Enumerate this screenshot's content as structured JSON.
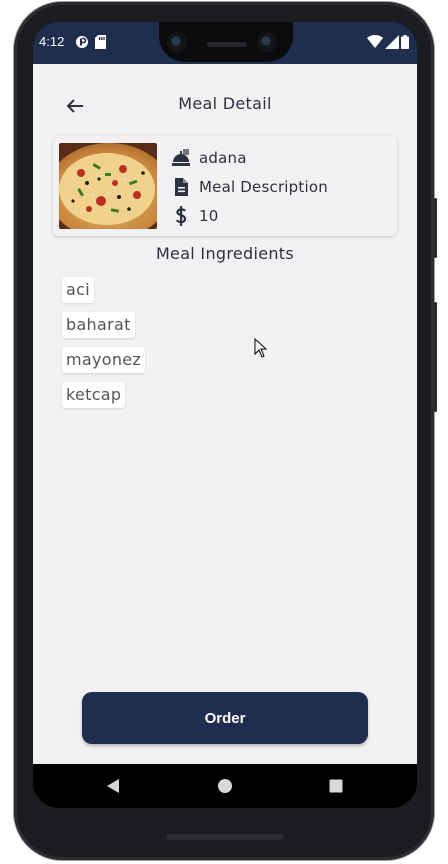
{
  "status_bar": {
    "time": "4:12"
  },
  "header": {
    "title": "Meal Detail"
  },
  "meal": {
    "name": "adana",
    "description": "Meal Description",
    "price": "10"
  },
  "ingredients": {
    "title": "Meal Ingredients",
    "items": [
      "aci",
      "baharat",
      "mayonez",
      "ketcap"
    ]
  },
  "order_button": {
    "label": "Order"
  },
  "colors": {
    "primary": "#1f2d4e",
    "background": "#f3f1f3",
    "text": "#2d3140"
  },
  "icons": {
    "back": "arrow-left-icon",
    "meal_name": "food-icon",
    "description": "document-icon",
    "price": "dollar-icon",
    "nav_back": "triangle-back-icon",
    "nav_home": "circle-home-icon",
    "nav_recents": "square-recents-icon"
  }
}
